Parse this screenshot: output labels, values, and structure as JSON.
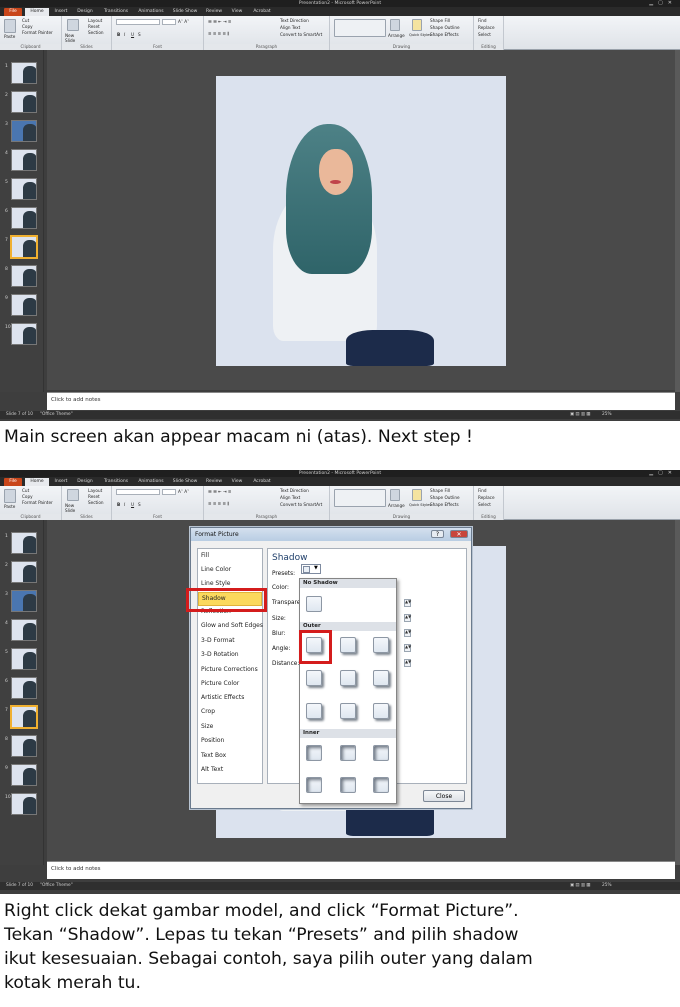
{
  "app": {
    "title": "Presentation2 - Microsoft PowerPoint",
    "tabs": [
      "File",
      "Home",
      "Insert",
      "Design",
      "Transitions",
      "Animations",
      "Slide Show",
      "Review",
      "View",
      "Acrobat"
    ],
    "clipboard": {
      "paste": "Paste",
      "cut": "Cut",
      "copy": "Copy",
      "format_painter": "Format Painter",
      "label": "Clipboard"
    },
    "slides": {
      "new_slide": "New Slide",
      "layout": "Layout",
      "reset": "Reset",
      "section": "Section",
      "label": "Slides"
    },
    "font": {
      "label": "Font",
      "bold": "B",
      "italic": "I",
      "underline": "U",
      "strike": "S"
    },
    "paragraph": {
      "label": "Paragraph",
      "text_direction": "Text Direction",
      "align_text": "Align Text",
      "convert_smartart": "Convert to SmartArt"
    },
    "drawing": {
      "label": "Drawing",
      "arrange": "Arrange",
      "quick_styles": "Quick Styles",
      "shape_fill": "Shape Fill",
      "shape_outline": "Shape Outline",
      "shape_effects": "Shape Effects"
    },
    "editing": {
      "label": "Editing",
      "find": "Find",
      "replace": "Replace",
      "select": "Select"
    },
    "slide_numbers": [
      "1",
      "2",
      "3",
      "4",
      "5",
      "6",
      "7",
      "8",
      "9",
      "10"
    ],
    "notes_placeholder": "Click to add notes",
    "status_slide": "Slide 7 of 10",
    "status_theme": "\"Office Theme\"",
    "zoom": "25%"
  },
  "dialog": {
    "title": "Format Picture",
    "categories": [
      "Fill",
      "Line Color",
      "Line Style",
      "Shadow",
      "Reflection",
      "Glow and Soft Edges",
      "3-D Format",
      "3-D Rotation",
      "Picture Corrections",
      "Picture Color",
      "Artistic Effects",
      "Crop",
      "Size",
      "Position",
      "Text Box",
      "Alt Text"
    ],
    "selected_category": "Shadow",
    "panel_title": "Shadow",
    "presets_label": "Presets:",
    "field_labels": [
      "Color:",
      "Transparency:",
      "Size:",
      "Blur:",
      "Angle:",
      "Distance:"
    ],
    "popup_headers": [
      "No Shadow",
      "Outer",
      "Inner"
    ],
    "close": "Close"
  },
  "captions": {
    "first": "Main screen akan appear macam ni (atas). Next step !",
    "second": [
      "Right click dekat gambar model, and click “Format Picture”.",
      "Tekan “Shadow”. Lepas tu tekan “Presets” and pilih shadow",
      "ikut kesesuaian. Sebagai contoh, saya pilih outer yang dalam",
      "kotak merah tu."
    ]
  },
  "colors": {
    "highlight_box": "#d41c1c",
    "selected_category": "#fbd95d",
    "file_tab": "#c8461b"
  }
}
